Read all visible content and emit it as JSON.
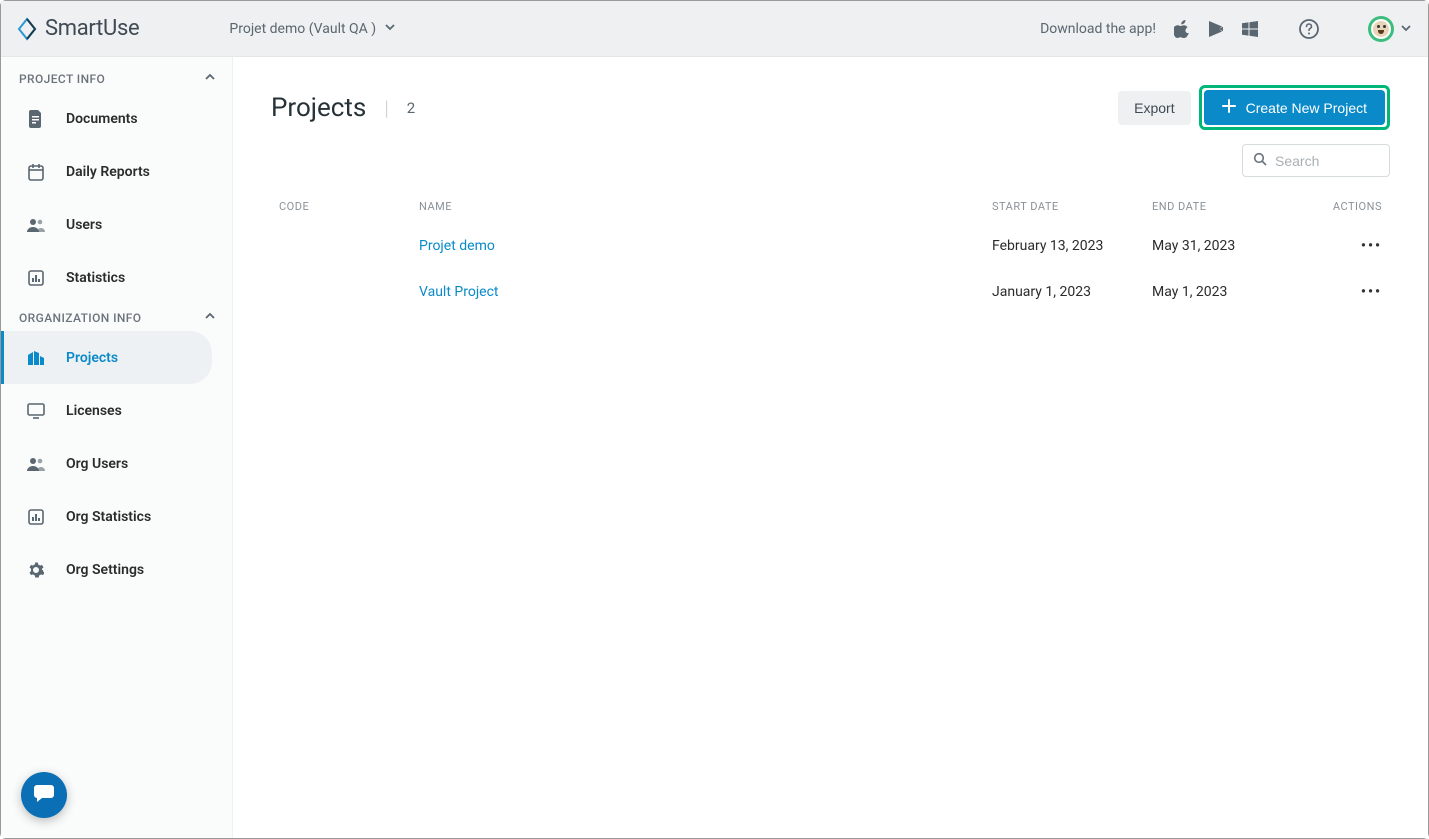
{
  "header": {
    "brand": "SmartUse",
    "project_selector": "Projet demo (Vault QA )",
    "download_label": "Download the app!"
  },
  "sidebar": {
    "section1": "PROJECT INFO",
    "section2": "ORGANIZATION INFO",
    "items1": [
      {
        "label": "Documents"
      },
      {
        "label": "Daily Reports"
      },
      {
        "label": "Users"
      },
      {
        "label": "Statistics"
      }
    ],
    "items2": [
      {
        "label": "Projects"
      },
      {
        "label": "Licenses"
      },
      {
        "label": "Org Users"
      },
      {
        "label": "Org Statistics"
      },
      {
        "label": "Org Settings"
      }
    ]
  },
  "main": {
    "title": "Projects",
    "count": "2",
    "export": "Export",
    "create": "Create New Project",
    "search_placeholder": "Search",
    "columns": {
      "code": "CODE",
      "name": "NAME",
      "start": "START DATE",
      "end": "END DATE",
      "actions": "ACTIONS"
    },
    "rows": [
      {
        "code": "",
        "name": "Projet demo",
        "start": "February 13, 2023",
        "end": "May 31, 2023"
      },
      {
        "code": "",
        "name": "Vault Project",
        "start": "January 1, 2023",
        "end": "May 1, 2023"
      }
    ]
  }
}
